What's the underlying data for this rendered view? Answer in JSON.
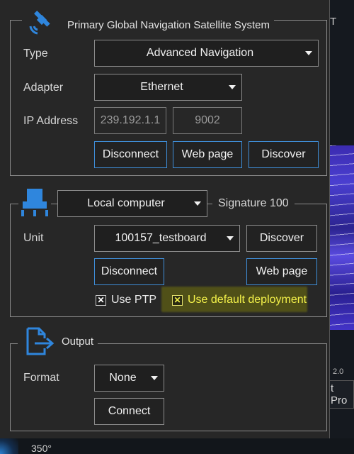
{
  "gnss": {
    "title": "Primary Global Navigation Satellite System",
    "type_label": "Type",
    "type_value": "Advanced Navigation",
    "adapter_label": "Adapter",
    "adapter_value": "Ethernet",
    "ip_label": "IP Address",
    "ip_value": "239.192.1.1",
    "port_value": "9002",
    "disconnect_label": "Disconnect",
    "webpage_label": "Web page",
    "discover_label": "Discover"
  },
  "unit_group": {
    "source_value": "Local computer",
    "signature_label": "Signature 100",
    "unit_label": "Unit",
    "unit_value": "100157_testboard",
    "discover_label": "Discover",
    "disconnect_label": "Disconnect",
    "webpage_label": "Web page",
    "use_ptp_label": "Use PTP",
    "use_ptp_checked": true,
    "use_default_label": "Use default deployment",
    "use_default_checked": true
  },
  "output": {
    "title": "Output",
    "format_label": "Format",
    "format_value": "None",
    "connect_label": "Connect"
  },
  "background": {
    "degree_label": "350°",
    "partial_t": "T",
    "partial_pro": "t Pro",
    "partial_small": "2.0"
  },
  "icons": {
    "satellite": "satellite-icon",
    "sensor": "sensor-unit-icon",
    "output": "file-export-icon",
    "caret": "chevron-down-icon"
  },
  "colors": {
    "accent_border": "#3f8ed8",
    "icon_blue": "#2f86dd",
    "highlight_text": "#f4f24a"
  }
}
